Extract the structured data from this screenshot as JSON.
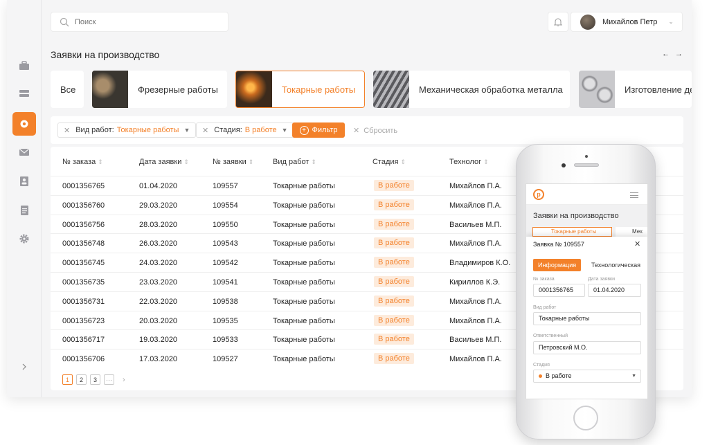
{
  "search": {
    "placeholder": "Поиск"
  },
  "user": {
    "name": "Михайлов Петр"
  },
  "page": {
    "title": "Заявки на производство"
  },
  "categories": [
    {
      "label": "Все"
    },
    {
      "label": "Фрезерные работы"
    },
    {
      "label": "Токарные работы"
    },
    {
      "label": "Механическая обработка металла"
    },
    {
      "label": "Изготовление де"
    }
  ],
  "filters": {
    "work_type_label": "Вид работ:",
    "work_type_value": "Токарные работы",
    "stage_label": "Стадия:",
    "stage_value": "В работе",
    "filter_button": "Фильтр",
    "reset": "Сбросить"
  },
  "table": {
    "headers": [
      "№ заказа",
      "Дата заявки",
      "№ заявки",
      "Вид работ",
      "Стадия",
      "Технолог"
    ],
    "rows": [
      [
        "0001356765",
        "01.04.2020",
        "109557",
        "Токарные работы",
        "В работе",
        "Михайлов П.А."
      ],
      [
        "0001356760",
        "29.03.2020",
        "109554",
        "Токарные работы",
        "В работе",
        "Михайлов П.А."
      ],
      [
        "0001356756",
        "28.03.2020",
        "109550",
        "Токарные работы",
        "В работе",
        "Васильев М.П."
      ],
      [
        "0001356748",
        "26.03.2020",
        "109543",
        "Токарные работы",
        "В работе",
        "Михайлов П.А."
      ],
      [
        "0001356745",
        "24.03.2020",
        "109542",
        "Токарные работы",
        "В работе",
        "Владимиров К.О."
      ],
      [
        "0001356735",
        "23.03.2020",
        "109541",
        "Токарные работы",
        "В работе",
        "Кириллов К.Э."
      ],
      [
        "0001356731",
        "22.03.2020",
        "109538",
        "Токарные работы",
        "В работе",
        "Михайлов П.А."
      ],
      [
        "0001356723",
        "20.03.2020",
        "109535",
        "Токарные работы",
        "В работе",
        "Михайлов П.А."
      ],
      [
        "0001356717",
        "19.03.2020",
        "109533",
        "Токарные работы",
        "В работе",
        "Васильев М.П."
      ],
      [
        "0001356706",
        "17.03.2020",
        "109527",
        "Токарные работы",
        "В работе",
        "Михайлов П.А."
      ]
    ]
  },
  "pagination": {
    "pages": [
      "1",
      "2",
      "3"
    ],
    "more": "···",
    "current": "1"
  },
  "mobile": {
    "title": "Заявки на производство",
    "cat_active": "Токарные работы",
    "cat_next": "Мех",
    "modal_title": "Заявка № 109557",
    "tab_info": "Информация",
    "tab_tech": "Технологическая",
    "order_label": "№ заказа",
    "order_value": "0001356765",
    "date_label": "Дата заявки",
    "date_value": "01.04.2020",
    "work_label": "Вид работ",
    "work_value": "Токарные работы",
    "resp_label": "Ответственный",
    "resp_value": "Петровский М.О.",
    "stage_label": "Стадия",
    "stage_value": "В работе"
  },
  "colors": {
    "accent": "#f3812a",
    "badge_bg": "#fdebdc"
  }
}
